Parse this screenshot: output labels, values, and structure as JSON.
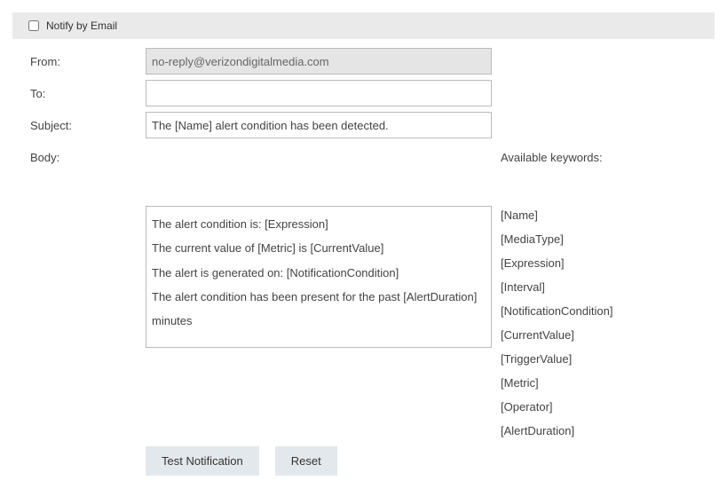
{
  "header": {
    "checkbox_label": "Notify by Email",
    "checked": false
  },
  "form": {
    "from_label": "From:",
    "from_value": "no-reply@verizondigitalmedia.com",
    "to_label": "To:",
    "to_value": "",
    "subject_label": "Subject:",
    "subject_value": "The [Name] alert condition has been detected.",
    "body_label": "Body:",
    "body_value": "The alert condition is: [Expression]\n\nThe current value of [Metric] is [CurrentValue]\n\nThe alert is generated on: [NotificationCondition]\n\nThe alert condition has been present for the past [AlertDuration] minutes"
  },
  "keywords": {
    "title": "Available keywords:",
    "items": [
      "[Name]",
      "[MediaType]",
      "[Expression]",
      "[Interval]",
      "[NotificationCondition]",
      "[CurrentValue]",
      "[TriggerValue]",
      "[Metric]",
      "[Operator]",
      "[AlertDuration]"
    ]
  },
  "buttons": {
    "test": "Test Notification",
    "reset": "Reset"
  }
}
